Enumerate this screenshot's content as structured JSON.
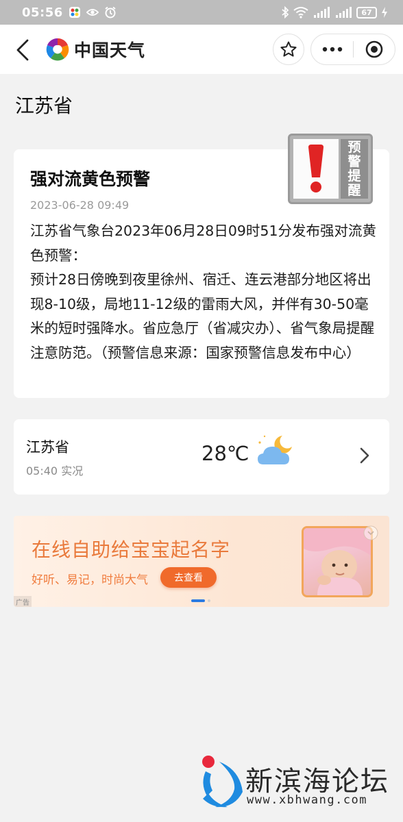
{
  "status_bar": {
    "time": "05:56",
    "battery": "67",
    "network": "4G 5G"
  },
  "nav": {
    "app_name": "中国天气"
  },
  "page": {
    "province": "江苏省"
  },
  "warning": {
    "title": "强对流黄色预警",
    "time": "2023-06-28 09:49",
    "body": "江苏省气象台2023年06月28日09时51分发布强对流黄色预警：\n预计28日傍晚到夜里徐州、宿迁、连云港部分地区将出现8-10级，局地11-12级的雷雨大风，并伴有30-50毫米的短时强降水。省应急厅（省减灾办）、省气象局提醒注意防范。（预警信息来源：国家预警信息发布中心）",
    "badge_line1": "预",
    "badge_line2": "警",
    "badge_line3": "提",
    "badge_line4": "醒"
  },
  "weather": {
    "location": "江苏省",
    "observed": "05:40 实况",
    "temperature": "28℃",
    "icon": "partly-cloudy-night-icon"
  },
  "ad": {
    "title": "在线自助给宝宝起名字",
    "subtitle": "好听、易记，时尚大气",
    "cta": "去查看",
    "tag": "广告"
  },
  "watermark": {
    "name": "新滨海论坛",
    "url": "www.xbhwang.com"
  },
  "colors": {
    "status_bar_bg": "#bdbdbd",
    "page_bg": "#f2f2f2",
    "ad_accent": "#e97a3c",
    "ad_button": "#f06a2b",
    "warning_exclaim": "#e02424",
    "watermark_blue": "#1f8be0",
    "watermark_red": "#e8283c"
  }
}
